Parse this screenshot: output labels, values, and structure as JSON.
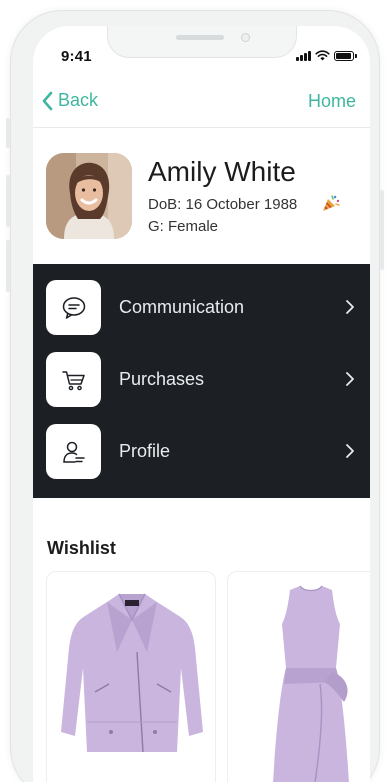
{
  "status_bar": {
    "time": "9:41"
  },
  "nav": {
    "back_label": "Back",
    "home_label": "Home"
  },
  "profile": {
    "name": "Amily White",
    "dob": "DoB: 16 October 1988",
    "gender": "G: Female"
  },
  "menu": {
    "items": [
      {
        "label": "Communication",
        "icon": "chat-bubble-icon"
      },
      {
        "label": "Purchases",
        "icon": "shopping-cart-icon"
      },
      {
        "label": "Profile",
        "icon": "person-document-icon"
      }
    ]
  },
  "wishlist": {
    "title": "Wishlist",
    "products": [
      {
        "name": "lilac suede biker jacket",
        "icon": "jacket-icon"
      },
      {
        "name": "lilac sleeveless dress",
        "icon": "dress-icon"
      }
    ]
  },
  "colors": {
    "accent": "#3fb6a0",
    "menu_background": "#1c1f23",
    "product_lilac": "#c9b5de"
  }
}
